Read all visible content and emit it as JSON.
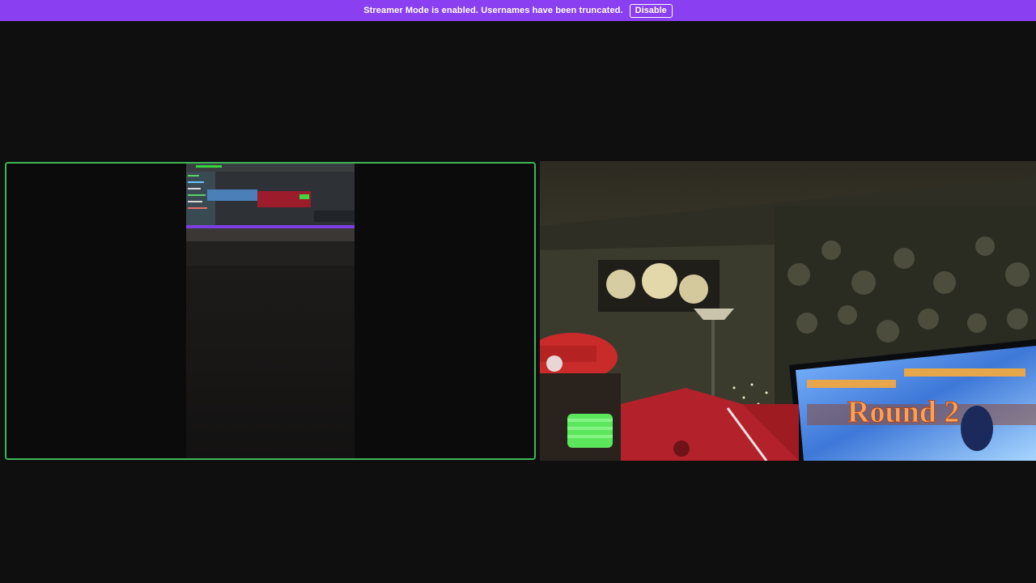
{
  "streamer_bar": {
    "message": "Streamer Mode is enabled. Usernames have been truncated.",
    "disable_label": "Disable",
    "background_color": "#8a3ff0"
  },
  "video_grid": {
    "tiles": [
      {
        "kind": "phone-camera-feed",
        "speaking": true,
        "speaking_border_color": "#3fb65a"
      },
      {
        "kind": "webcam-feed",
        "speaking": false,
        "tv_screen_text": "Round 2"
      }
    ]
  }
}
